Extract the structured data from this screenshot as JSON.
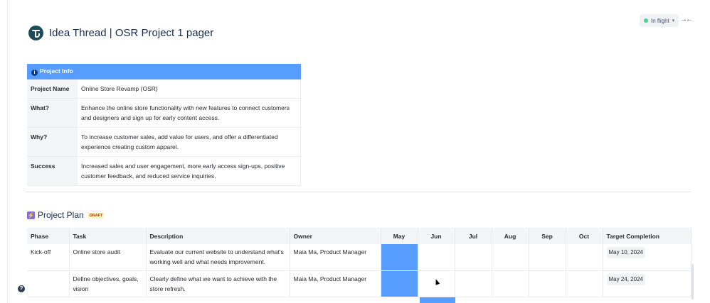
{
  "page": {
    "title": "Idea Thread | OSR Project 1 pager",
    "status_label": "In flight"
  },
  "info_table": {
    "header": "Project Info",
    "rows": [
      {
        "label": "Project Name",
        "value": "Online Store Revamp (OSR)"
      },
      {
        "label": "What?",
        "value": "Enhance the online store functionality with new features to connect customers and designers and sign up for early content access."
      },
      {
        "label": "Why?",
        "value": "To increase customer sales, add value for users, and offer a differentiated experience creating custom apparel."
      },
      {
        "label": "Success",
        "value": "Increased sales and user engagement, more early access sign-ups, positive customer feedback, and reduced service inquiries."
      }
    ]
  },
  "plan": {
    "title": "Project Plan",
    "badge": "DRAFT",
    "columns": [
      "Phase",
      "Task",
      "Description",
      "Owner",
      "May",
      "Jun",
      "Jul",
      "Aug",
      "Sep",
      "Oct",
      "Target Completion"
    ],
    "rows": [
      {
        "phase": "Kick-off",
        "task": "Online store audit",
        "description": "Evaluate our current website to understand what's working well and what needs improvement.",
        "owner": "Maia Ma, Product Manager",
        "target": "May 10, 2024",
        "filled_months": [
          "May"
        ]
      },
      {
        "phase": "",
        "task": "Define objectives, goals, vision",
        "description": "Clearly define what we want to achieve with the store refresh.",
        "owner": "Maia Ma, Product Manager",
        "target": "May 24, 2024",
        "filled_months": [
          "May"
        ]
      }
    ]
  },
  "colors": {
    "accent": "#579dff",
    "status_dot": "#4bce97",
    "logo": "#1f4a5a"
  }
}
